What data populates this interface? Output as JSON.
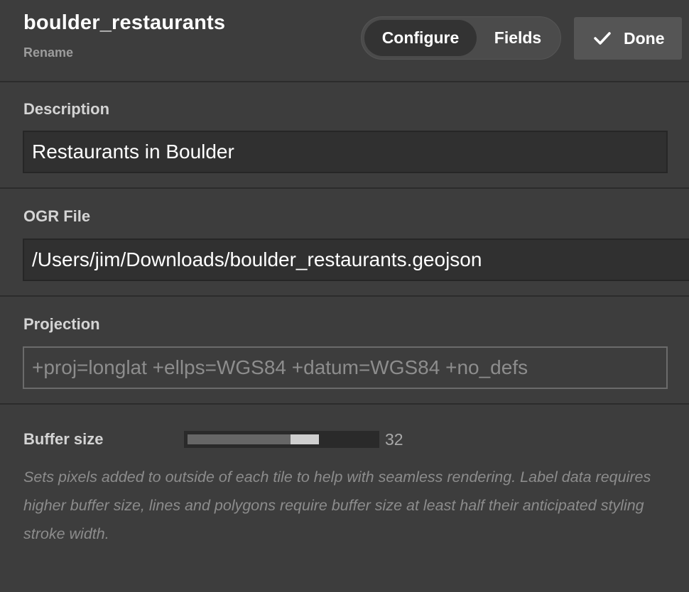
{
  "header": {
    "title": "boulder_restaurants",
    "rename_label": "Rename",
    "tabs": [
      {
        "label": "Configure",
        "active": true
      },
      {
        "label": "Fields",
        "active": false
      }
    ],
    "done_label": "Done",
    "done_icon": "check-icon"
  },
  "description": {
    "label": "Description",
    "value": "Restaurants in Boulder"
  },
  "ogr_file": {
    "label": "OGR File",
    "value": "/Users/jim/Downloads/boulder_restaurants.geojson"
  },
  "projection": {
    "label": "Projection",
    "placeholder": "+proj=longlat +ellps=WGS84 +datum=WGS84 +no_defs"
  },
  "buffer_size": {
    "label": "Buffer size",
    "value": "32",
    "level_fraction": 0.57,
    "help": "Sets pixels added to outside of each tile to help with seamless rendering. Label data requires higher buffer size, lines and polygons require buffer size at least half their anticipated styling stroke width."
  },
  "colors": {
    "background": "#3d3d3d",
    "input_background": "#303030",
    "active_tab": "#333333",
    "done_button": "#555555"
  }
}
